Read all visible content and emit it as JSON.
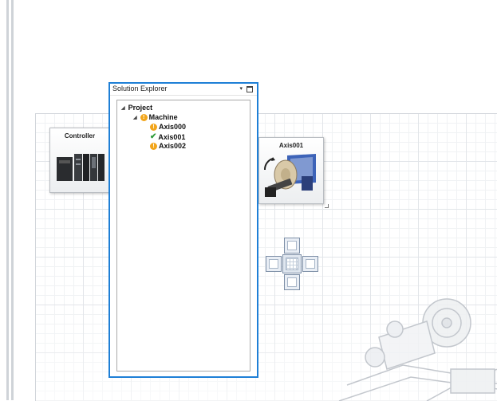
{
  "solution_explorer": {
    "title": "Solution Explorer",
    "dropdown_glyph": "▾",
    "tree": {
      "project": "Project",
      "machine": "Machine",
      "axes": [
        {
          "label": "Axis000",
          "status": "warning"
        },
        {
          "label": "Axis001",
          "status": "ok"
        },
        {
          "label": "Axis002",
          "status": "warning"
        }
      ]
    }
  },
  "canvas": {
    "controller_card": {
      "title": "Controller",
      "icon": "controller-icon"
    },
    "axis_card": {
      "title": "Axis001",
      "icon": "axis-motor-icon"
    }
  },
  "colors": {
    "focus_border": "#1e7fd6",
    "warning": "#f2a51a",
    "ok": "#2e9b3a"
  }
}
